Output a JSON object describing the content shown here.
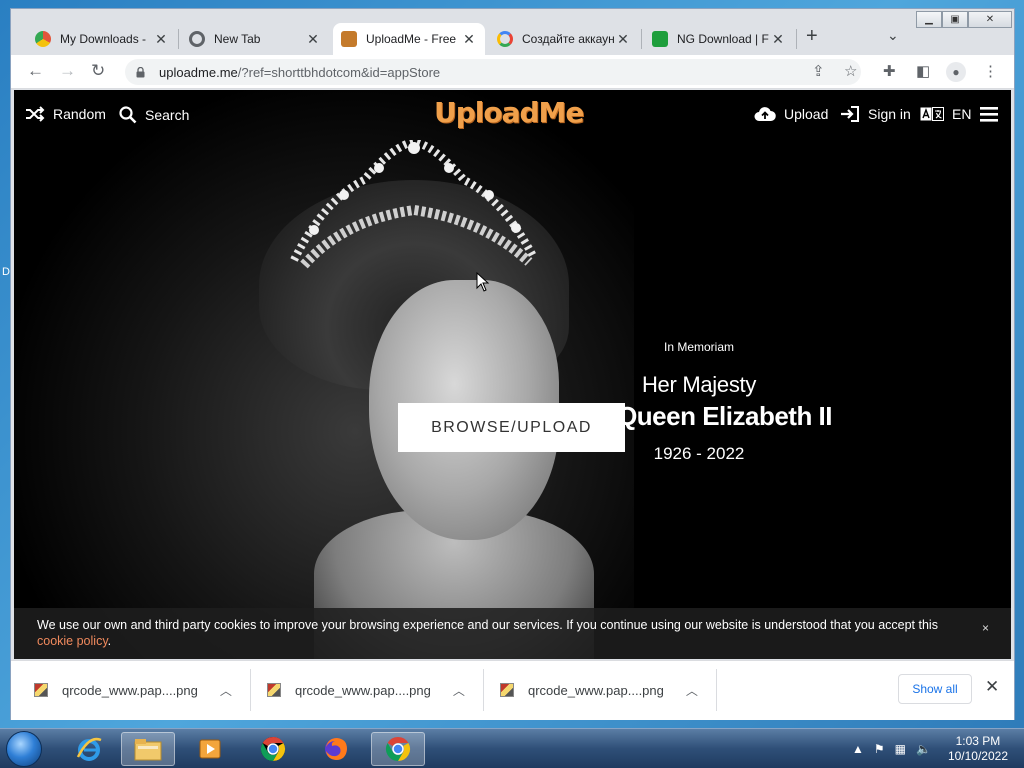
{
  "desktop": {
    "stub_letter": "D"
  },
  "browser": {
    "tabs": [
      {
        "title": "My Downloads -",
        "favicon_color": "#e2553a"
      },
      {
        "title": "New Tab",
        "favicon_color": "#5f6368"
      },
      {
        "title": "UploadMe - Free",
        "favicon_color": "#c47a2b",
        "active": true
      },
      {
        "title": "Создайте аккаун",
        "favicon_color": "#4285f4"
      },
      {
        "title": "NG Download | F",
        "favicon_color": "#1e9e3c"
      }
    ],
    "url_host": "uploadme.me",
    "url_rest": "/?ref=shorttbhdotcom&id=appStore"
  },
  "site": {
    "nav_random": "Random",
    "nav_search": "Search",
    "logo": "UploadMe",
    "nav_upload": "Upload",
    "nav_signin": "Sign in",
    "nav_lang": "EN",
    "memoriam_small": "In Memoriam",
    "memoriam_title": "Her Majesty",
    "memoriam_name": "Queen Elizabeth II",
    "memoriam_years": "1926 - 2022",
    "browse_button": "BROWSE/UPLOAD",
    "cookie_text": "We use our own and third party cookies to improve your browsing experience and our services. If you continue using our website is understood that you accept this ",
    "cookie_link": "cookie policy",
    "cookie_end": ".",
    "cookie_close": "×"
  },
  "downloads": {
    "items": [
      {
        "name": "qrcode_www.pap....png"
      },
      {
        "name": "qrcode_www.pap....png"
      },
      {
        "name": "qrcode_www.pap....png"
      }
    ],
    "show_all": "Show all"
  },
  "taskbar": {
    "time": "1:03 PM",
    "date": "10/10/2022"
  }
}
